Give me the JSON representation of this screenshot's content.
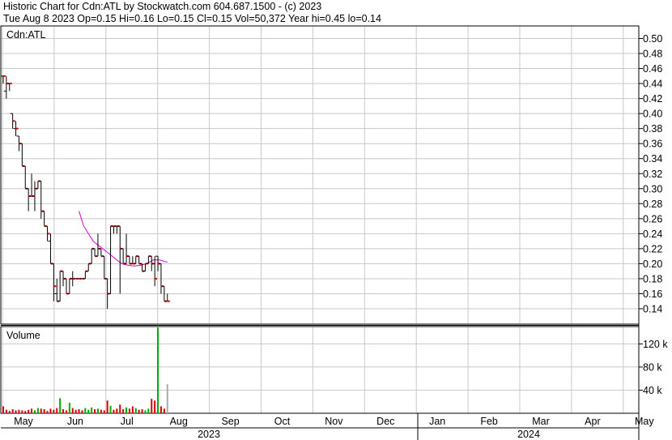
{
  "header": {
    "title": "Historic Chart for Cdn:ATL by Stockwatch.com 604.687.1500 - (c) 2023",
    "quote": "Tue Aug  8 2023  Op=0.15  Hi=0.16  Lo=0.15  Cl=0.15  Vol=50,372  Year hi=0.45  lo=0.14"
  },
  "chart_data": {
    "type": "ohlc",
    "symbol_label": "Cdn:ATL",
    "price_axis": {
      "min": 0.14,
      "max": 0.5,
      "ticks": [
        "0.50",
        "0.48",
        "0.46",
        "0.44",
        "0.42",
        "0.40",
        "0.38",
        "0.36",
        "0.34",
        "0.32",
        "0.30",
        "0.28",
        "0.26",
        "0.24",
        "0.22",
        "0.20",
        "0.18",
        "0.16",
        "0.14"
      ]
    },
    "volume_label": "Volume",
    "volume_axis": {
      "max": 150000,
      "ticks": [
        {
          "label": "120 k",
          "value": 120000
        },
        {
          "label": "80 k",
          "value": 80000
        },
        {
          "label": "40 k",
          "value": 40000
        }
      ]
    },
    "months": [
      "May",
      "Jun",
      "Jul",
      "Aug",
      "Sep",
      "Oct",
      "Nov",
      "Dec",
      "Jan",
      "Feb",
      "Mar",
      "Apr",
      "May"
    ],
    "years": [
      "2023",
      "2024"
    ],
    "grid": true,
    "moving_average_color": "#cc00cc",
    "up_color": "#00aa00",
    "down_color": "#dd0000",
    "bars": [
      {
        "d": 1,
        "o": 0.45,
        "h": 0.45,
        "l": 0.44,
        "c": 0.45,
        "v": 12000
      },
      {
        "d": 3,
        "o": 0.43,
        "h": 0.45,
        "l": 0.42,
        "c": 0.44,
        "v": 6000
      },
      {
        "d": 5,
        "o": 0.44,
        "h": 0.44,
        "l": 0.43,
        "c": 0.44,
        "v": 4000
      },
      {
        "d": 7,
        "o": 0.4,
        "h": 0.4,
        "l": 0.38,
        "c": 0.39,
        "v": 7000
      },
      {
        "d": 9,
        "o": 0.38,
        "h": 0.39,
        "l": 0.37,
        "c": 0.38,
        "v": 5000
      },
      {
        "d": 11,
        "o": 0.37,
        "h": 0.37,
        "l": 0.35,
        "c": 0.36,
        "v": 6000
      },
      {
        "d": 13,
        "o": 0.36,
        "h": 0.36,
        "l": 0.33,
        "c": 0.33,
        "v": 5000
      },
      {
        "d": 15,
        "o": 0.33,
        "h": 0.33,
        "l": 0.3,
        "c": 0.3,
        "v": 4000
      },
      {
        "d": 17,
        "o": 0.3,
        "h": 0.3,
        "l": 0.27,
        "c": 0.29,
        "v": 6000
      },
      {
        "d": 19,
        "o": 0.29,
        "h": 0.32,
        "l": 0.29,
        "c": 0.29,
        "v": 8000
      },
      {
        "d": 21,
        "o": 0.29,
        "h": 0.31,
        "l": 0.27,
        "c": 0.3,
        "v": 5000
      },
      {
        "d": 23,
        "o": 0.3,
        "h": 0.31,
        "l": 0.3,
        "c": 0.31,
        "v": 9000
      },
      {
        "d": 25,
        "o": 0.31,
        "h": 0.31,
        "l": 0.26,
        "c": 0.27,
        "v": 8000
      },
      {
        "d": 27,
        "o": 0.27,
        "h": 0.27,
        "l": 0.25,
        "c": 0.25,
        "v": 7000
      },
      {
        "d": 29,
        "o": 0.25,
        "h": 0.25,
        "l": 0.23,
        "c": 0.24,
        "v": 4000
      },
      {
        "d": 31,
        "o": 0.23,
        "h": 0.24,
        "l": 0.2,
        "c": 0.2,
        "v": 8000
      },
      {
        "d": 33,
        "o": 0.2,
        "h": 0.2,
        "l": 0.15,
        "c": 0.17,
        "v": 6000
      },
      {
        "d": 35,
        "o": 0.16,
        "h": 0.18,
        "l": 0.15,
        "c": 0.15,
        "v": 9000
      },
      {
        "d": 37,
        "o": 0.15,
        "h": 0.19,
        "l": 0.15,
        "c": 0.19,
        "v": 26000
      },
      {
        "d": 39,
        "o": 0.19,
        "h": 0.19,
        "l": 0.17,
        "c": 0.18,
        "v": 7000
      },
      {
        "d": 41,
        "o": 0.18,
        "h": 0.18,
        "l": 0.16,
        "c": 0.16,
        "v": 5000
      },
      {
        "d": 43,
        "o": 0.16,
        "h": 0.18,
        "l": 0.16,
        "c": 0.18,
        "v": 18000
      },
      {
        "d": 45,
        "o": 0.18,
        "h": 0.19,
        "l": 0.17,
        "c": 0.18,
        "v": 9000
      },
      {
        "d": 47,
        "o": 0.18,
        "h": 0.18,
        "l": 0.18,
        "c": 0.18,
        "v": 6000
      },
      {
        "d": 49,
        "o": 0.18,
        "h": 0.18,
        "l": 0.18,
        "c": 0.18,
        "v": 7000
      },
      {
        "d": 51,
        "o": 0.18,
        "h": 0.18,
        "l": 0.18,
        "c": 0.18,
        "v": 5000
      },
      {
        "d": 53,
        "o": 0.18,
        "h": 0.19,
        "l": 0.18,
        "c": 0.19,
        "v": 9000
      },
      {
        "d": 55,
        "o": 0.19,
        "h": 0.2,
        "l": 0.19,
        "c": 0.2,
        "v": 6000
      },
      {
        "d": 57,
        "o": 0.2,
        "h": 0.22,
        "l": 0.2,
        "c": 0.22,
        "v": 10000
      },
      {
        "d": 59,
        "o": 0.22,
        "h": 0.22,
        "l": 0.21,
        "c": 0.21,
        "v": 7000
      },
      {
        "d": 61,
        "o": 0.21,
        "h": 0.24,
        "l": 0.21,
        "c": 0.22,
        "v": 8000
      },
      {
        "d": 63,
        "o": 0.22,
        "h": 0.22,
        "l": 0.21,
        "c": 0.21,
        "v": 6000
      },
      {
        "d": 65,
        "o": 0.21,
        "h": 0.21,
        "l": 0.18,
        "c": 0.18,
        "v": 5000
      },
      {
        "d": 67,
        "o": 0.18,
        "h": 0.18,
        "l": 0.14,
        "c": 0.16,
        "v": 22000
      },
      {
        "d": 69,
        "o": 0.16,
        "h": 0.25,
        "l": 0.16,
        "c": 0.25,
        "v": 13000
      },
      {
        "d": 71,
        "o": 0.25,
        "h": 0.25,
        "l": 0.24,
        "c": 0.25,
        "v": 6000
      },
      {
        "d": 73,
        "o": 0.25,
        "h": 0.25,
        "l": 0.24,
        "c": 0.25,
        "v": 8000
      },
      {
        "d": 75,
        "o": 0.25,
        "h": 0.25,
        "l": 0.16,
        "c": 0.22,
        "v": 15000
      },
      {
        "d": 77,
        "o": 0.22,
        "h": 0.22,
        "l": 0.2,
        "c": 0.2,
        "v": 7000
      },
      {
        "d": 79,
        "o": 0.2,
        "h": 0.24,
        "l": 0.2,
        "c": 0.21,
        "v": 10000
      },
      {
        "d": 81,
        "o": 0.21,
        "h": 0.21,
        "l": 0.2,
        "c": 0.2,
        "v": 8000
      },
      {
        "d": 83,
        "o": 0.2,
        "h": 0.21,
        "l": 0.2,
        "c": 0.2,
        "v": 12000
      },
      {
        "d": 85,
        "o": 0.2,
        "h": 0.21,
        "l": 0.2,
        "c": 0.21,
        "v": 9000
      },
      {
        "d": 87,
        "o": 0.21,
        "h": 0.21,
        "l": 0.2,
        "c": 0.2,
        "v": 6000
      },
      {
        "d": 89,
        "o": 0.2,
        "h": 0.2,
        "l": 0.19,
        "c": 0.19,
        "v": 7000
      },
      {
        "d": 91,
        "o": 0.19,
        "h": 0.2,
        "l": 0.19,
        "c": 0.2,
        "v": 5000
      },
      {
        "d": 93,
        "o": 0.2,
        "h": 0.21,
        "l": 0.2,
        "c": 0.21,
        "v": 8000
      },
      {
        "d": 95,
        "o": 0.21,
        "h": 0.21,
        "l": 0.19,
        "c": 0.2,
        "v": 25000
      },
      {
        "d": 97,
        "o": 0.2,
        "h": 0.21,
        "l": 0.17,
        "c": 0.18,
        "v": 22000
      },
      {
        "d": 99,
        "o": 0.21,
        "h": 0.21,
        "l": 0.19,
        "c": 0.2,
        "v": 148000
      },
      {
        "d": 101,
        "o": 0.2,
        "h": 0.2,
        "l": 0.16,
        "c": 0.17,
        "v": 12000
      },
      {
        "d": 103,
        "o": 0.17,
        "h": 0.17,
        "l": 0.15,
        "c": 0.15,
        "v": 8000
      },
      {
        "d": 105,
        "o": 0.15,
        "h": 0.16,
        "l": 0.15,
        "c": 0.15,
        "v": 50372
      }
    ],
    "moving_average": [
      [
        49,
        0.27
      ],
      [
        52,
        0.25
      ],
      [
        55,
        0.24
      ],
      [
        58,
        0.23
      ],
      [
        61,
        0.225
      ],
      [
        64,
        0.22
      ],
      [
        67,
        0.215
      ],
      [
        70,
        0.21
      ],
      [
        73,
        0.205
      ],
      [
        76,
        0.2
      ],
      [
        80,
        0.198
      ],
      [
        84,
        0.197
      ],
      [
        88,
        0.198
      ],
      [
        92,
        0.2
      ],
      [
        96,
        0.205
      ],
      [
        100,
        0.205
      ],
      [
        105,
        0.202
      ]
    ]
  }
}
